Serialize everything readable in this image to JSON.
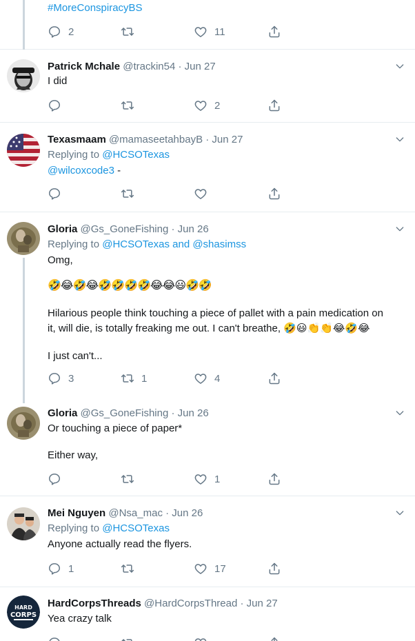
{
  "top": {
    "hashtag": "#MoreConspiracyBS",
    "replies": "2",
    "retweets": "",
    "likes": "11"
  },
  "tweets": [
    {
      "name": "Patrick Mchale",
      "handle": "@trackin54",
      "date": "· Jun 27",
      "replying": "",
      "replying_to": "",
      "body": [
        "I did"
      ],
      "replies": "",
      "retweets": "",
      "likes": "2"
    },
    {
      "name": "Texasmaam",
      "handle": "@mamaseetahbayB",
      "date": "· Jun 27",
      "replying": "Replying to ",
      "replying_to": "@HCSOTexas",
      "mention": "@wilcoxcode3",
      "mention_suffix": " -",
      "replies": "",
      "retweets": "",
      "likes": ""
    },
    {
      "name": "Gloria",
      "handle": "@Gs_GoneFishing",
      "date": "· Jun 26",
      "replying": "Replying to ",
      "replying_to": "@HCSOTexas and @shasimss",
      "body": [
        "Omg,",
        "🤣😂🤣😂🤣🤣🤣🤣😂😂😃🤣🤣",
        "Hilarious people think touching a piece of pallet with a pain medication on",
        "it, will die, is totally freaking me out. I can't breathe, 🤣😃👏👏😂🤣😂",
        "I just can't..."
      ],
      "replies": "3",
      "retweets": "1",
      "likes": "4"
    },
    {
      "name": "Gloria",
      "handle": "@Gs_GoneFishing",
      "date": "· Jun 26",
      "replying": "",
      "replying_to": "",
      "body": [
        "Or touching a piece of paper*",
        "Either way,"
      ],
      "replies": "",
      "retweets": "",
      "likes": "1"
    },
    {
      "name": "Mei Nguyen",
      "handle": "@Nsa_mac",
      "date": "· Jun 26",
      "replying": "Replying to ",
      "replying_to": "@HCSOTexas",
      "body": [
        "Anyone actually read the flyers."
      ],
      "replies": "1",
      "retweets": "",
      "likes": "17"
    },
    {
      "name": "HardCorpsThreads",
      "handle": "@HardCorpsThread",
      "date": "· Jun 27",
      "replying": "",
      "replying_to": "",
      "body": [
        "Yea crazy talk"
      ],
      "replies": "",
      "retweets": "",
      "likes": ""
    }
  ],
  "colors": {
    "link": "#1b95e0",
    "gray": "#657786",
    "line": "#ccd6dd",
    "divider": "#e6ecf0"
  }
}
